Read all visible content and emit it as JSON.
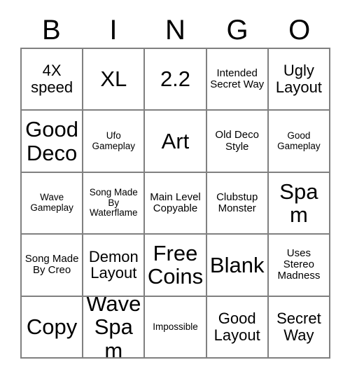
{
  "card": {
    "headers": [
      "B",
      "I",
      "N",
      "G",
      "O"
    ],
    "cells": [
      {
        "text": "4X speed",
        "size": "md"
      },
      {
        "text": "XL",
        "size": "xl"
      },
      {
        "text": "2.2",
        "size": "xl"
      },
      {
        "text": "Intended Secret Way",
        "size": "sm"
      },
      {
        "text": "Ugly Layout",
        "size": "md"
      },
      {
        "text": "Good Deco",
        "size": "xl"
      },
      {
        "text": "Ufo Gameplay",
        "size": "xs"
      },
      {
        "text": "Art",
        "size": "xl"
      },
      {
        "text": "Old Deco Style",
        "size": "sm"
      },
      {
        "text": "Good Gameplay",
        "size": "xs"
      },
      {
        "text": "Wave Gameplay",
        "size": "xs"
      },
      {
        "text": "Song Made By Waterflame",
        "size": "xs"
      },
      {
        "text": "Main Level Copyable",
        "size": "sm"
      },
      {
        "text": "Clubstup Monster",
        "size": "sm"
      },
      {
        "text": "Spam",
        "size": "xl"
      },
      {
        "text": "Song Made By Creo",
        "size": "sm"
      },
      {
        "text": "Demon Layout",
        "size": "md"
      },
      {
        "text": "Free Coins",
        "size": "xl"
      },
      {
        "text": "Blank",
        "size": "xl"
      },
      {
        "text": "Uses Stereo Madness",
        "size": "sm"
      },
      {
        "text": "Copy",
        "size": "xl"
      },
      {
        "text": "Wave Spam",
        "size": "xl"
      },
      {
        "text": "Impossible",
        "size": "xs"
      },
      {
        "text": "Good Layout",
        "size": "md"
      },
      {
        "text": "Secret Way",
        "size": "md"
      }
    ]
  },
  "colors": {
    "border": "#808080",
    "text": "#000000",
    "background": "#ffffff"
  }
}
